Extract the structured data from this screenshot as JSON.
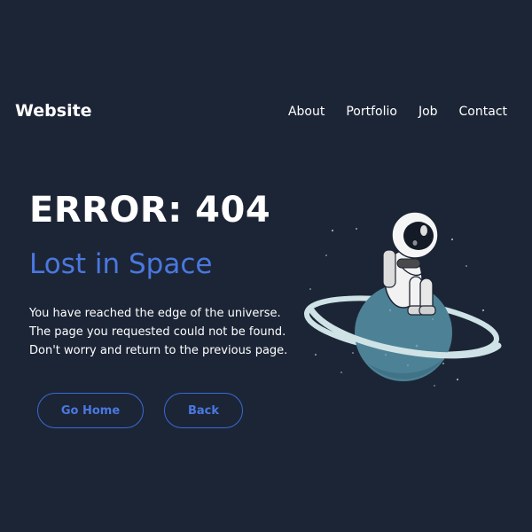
{
  "header": {
    "brand": "Website",
    "nav": [
      "About",
      "Portfolio",
      "Job",
      "Contact"
    ]
  },
  "main": {
    "title": "ERROR: 404",
    "subtitle": "Lost in Space",
    "message_lines": [
      "You have reached the edge of the universe.",
      "The page you requested could not be found.",
      "Don't worry and return to the previous page."
    ],
    "buttons": {
      "home": "Go Home",
      "back": "Back"
    }
  },
  "illustration": {
    "icon": "astronaut-on-planet-icon"
  },
  "colors": {
    "background": "#1c2536",
    "accent": "#4a78e0",
    "text": "#ffffff",
    "planet": "#4d8296",
    "ring": "#cfe3e6"
  }
}
